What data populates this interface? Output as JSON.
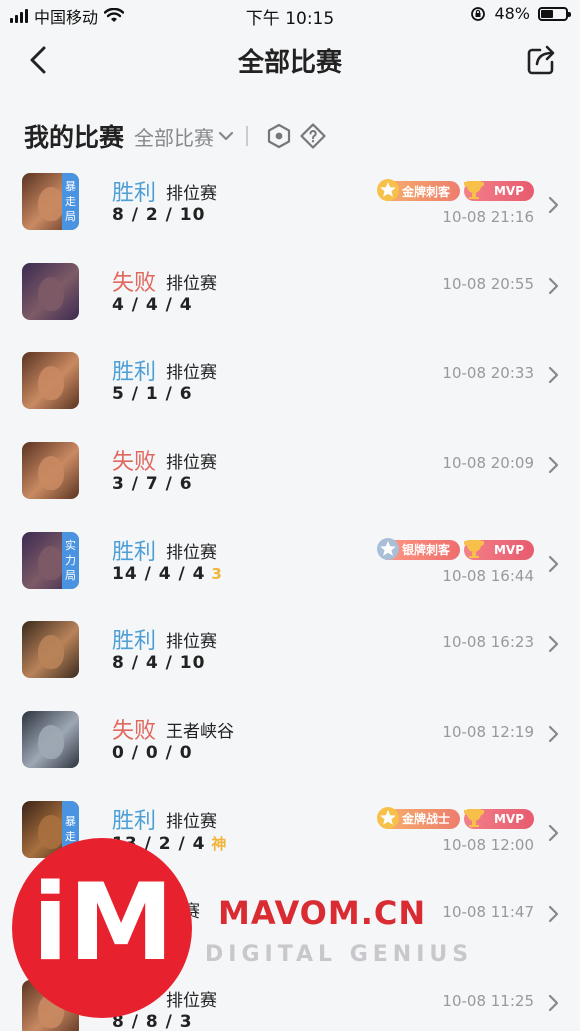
{
  "status_bar": {
    "carrier": "中国移动",
    "time": "下午 10:15",
    "battery": "48%",
    "battery_level": 0.48
  },
  "nav": {
    "title": "全部比赛"
  },
  "section": {
    "title": "我的比赛",
    "filter": "全部比赛"
  },
  "matches": [
    {
      "result": "胜利",
      "outcome": "win",
      "mode": "排位赛",
      "kda": "8 / 2 / 10",
      "kda_extra": "",
      "time": "10-08 21:16",
      "tag": [
        "暴",
        "走",
        "局"
      ],
      "badge1": "金牌刺客",
      "badge1_type": "gold",
      "mvp": "MVP",
      "hero_colors": [
        "#5a3322",
        "#c98a62"
      ]
    },
    {
      "result": "失败",
      "outcome": "loss",
      "mode": "排位赛",
      "kda": "4 / 4 / 4",
      "kda_extra": "",
      "time": "10-08 20:55",
      "tag": [],
      "badge1": "",
      "badge1_type": "",
      "mvp": "",
      "hero_colors": [
        "#3b2b52",
        "#7d5a66"
      ]
    },
    {
      "result": "胜利",
      "outcome": "win",
      "mode": "排位赛",
      "kda": "5 / 1 / 6",
      "kda_extra": "",
      "time": "10-08 20:33",
      "tag": [],
      "badge1": "",
      "badge1_type": "",
      "mvp": "",
      "hero_colors": [
        "#5a3322",
        "#c98a62"
      ]
    },
    {
      "result": "失败",
      "outcome": "loss",
      "mode": "排位赛",
      "kda": "3 / 7 / 6",
      "kda_extra": "",
      "time": "10-08 20:09",
      "tag": [],
      "badge1": "",
      "badge1_type": "",
      "mvp": "",
      "hero_colors": [
        "#5a3322",
        "#c98a62"
      ]
    },
    {
      "result": "胜利",
      "outcome": "win",
      "mode": "排位赛",
      "kda": "14 / 4 / 4",
      "kda_extra": "3",
      "time": "10-08 16:44",
      "tag": [
        "实",
        "力",
        "局"
      ],
      "badge1": "银牌刺客",
      "badge1_type": "silver",
      "mvp": "MVP",
      "hero_colors": [
        "#3b2b52",
        "#7d5a66"
      ]
    },
    {
      "result": "胜利",
      "outcome": "win",
      "mode": "排位赛",
      "kda": "8 / 4 / 10",
      "kda_extra": "",
      "time": "10-08 16:23",
      "tag": [],
      "badge1": "",
      "badge1_type": "",
      "mvp": "",
      "hero_colors": [
        "#3a2a1e",
        "#b98359"
      ]
    },
    {
      "result": "失败",
      "outcome": "loss",
      "mode": "王者峡谷",
      "kda": "0 / 0 / 0",
      "kda_extra": "",
      "time": "10-08 12:19",
      "tag": [],
      "badge1": "",
      "badge1_type": "",
      "mvp": "",
      "hero_colors": [
        "#2d3440",
        "#9ea8b4"
      ]
    },
    {
      "result": "胜利",
      "outcome": "win",
      "mode": "排位赛",
      "kda": "13 / 2 / 4",
      "kda_extra": "神",
      "time": "10-08 12:00",
      "tag": [
        "暴",
        "走"
      ],
      "badge1": "金牌战士",
      "badge1_type": "gold",
      "mvp": "MVP",
      "hero_colors": [
        "#3a2318",
        "#a8703e"
      ]
    },
    {
      "result": "",
      "outcome": "win",
      "mode": "位赛",
      "kda": "",
      "kda_extra": "",
      "time": "10-08 11:47",
      "tag": [],
      "badge1": "",
      "badge1_type": "",
      "mvp": "",
      "hero_colors": [
        "#5a3322",
        "#c98a62"
      ]
    },
    {
      "result": "败",
      "outcome": "loss",
      "mode": "排位赛",
      "kda": "8 / 8 / 3",
      "kda_extra": "",
      "time": "10-08 11:25",
      "tag": [],
      "badge1": "",
      "badge1_type": "",
      "mvp": "",
      "hero_colors": [
        "#5a3322",
        "#c98a62"
      ]
    }
  ],
  "watermark": {
    "logo": "iM",
    "brand": "MAVOM.CN",
    "tagline": "DIGITAL GENIUS"
  }
}
